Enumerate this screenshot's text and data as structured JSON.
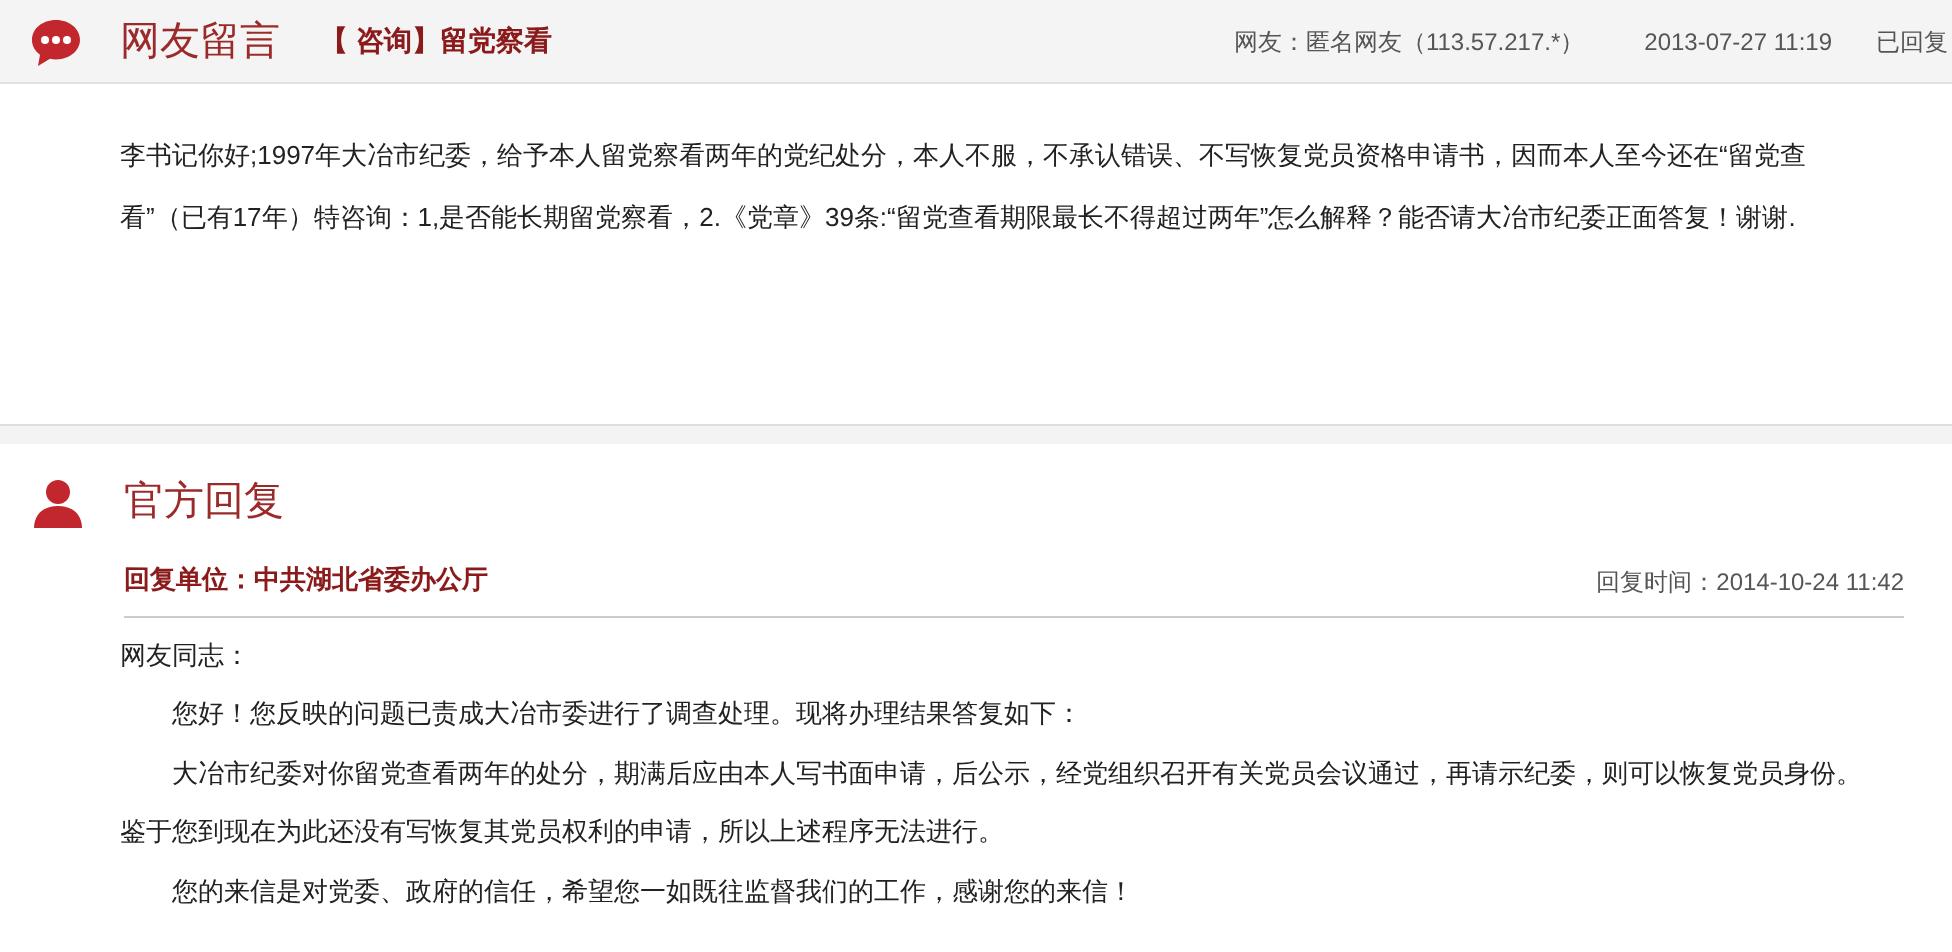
{
  "message": {
    "title": "网友留言",
    "subject": "【 咨询】留党察看",
    "author": "网友：匿名网友（113.57.217.*）",
    "time": "2013-07-27 11:19",
    "status": "已回复",
    "body": "李书记你好;1997年大冶市纪委，给予本人留党察看两年的党纪处分，本人不服，不承认错误、不写恢复党员资格申请书，因而本人至今还在“留党查看”（已有17年）特咨询：1,是否能长期留党察看，2.《党章》39条:“留党查看期限最长不得超过两年”怎么解释？能否请大冶市纪委正面答复！谢谢."
  },
  "reply": {
    "title": "官方回复",
    "unit": "回复单位：中共湖北省委办公厅",
    "time": "回复时间：2014-10-24 11:42",
    "paragraphs": [
      {
        "kind": "salutation",
        "text": "网友同志："
      },
      {
        "kind": "indented",
        "text": "您好！您反映的问题已责成大冶市委进行了调查处理。现将办理结果答复如下："
      },
      {
        "kind": "indented",
        "text": "大冶市纪委对你留党查看两年的处分，期满后应由本人写书面申请，后公示，经党组织召开有关党员会议通过，再请示纪委，则可以恢复党员身份。鉴于您到现在为此还没有写恢复其党员权利的申请，所以上述程序无法进行。"
      },
      {
        "kind": "indented",
        "text": "您的来信是对党委、政府的信任，希望您一如既往监督我们的工作，感谢您的来信！"
      }
    ]
  }
}
